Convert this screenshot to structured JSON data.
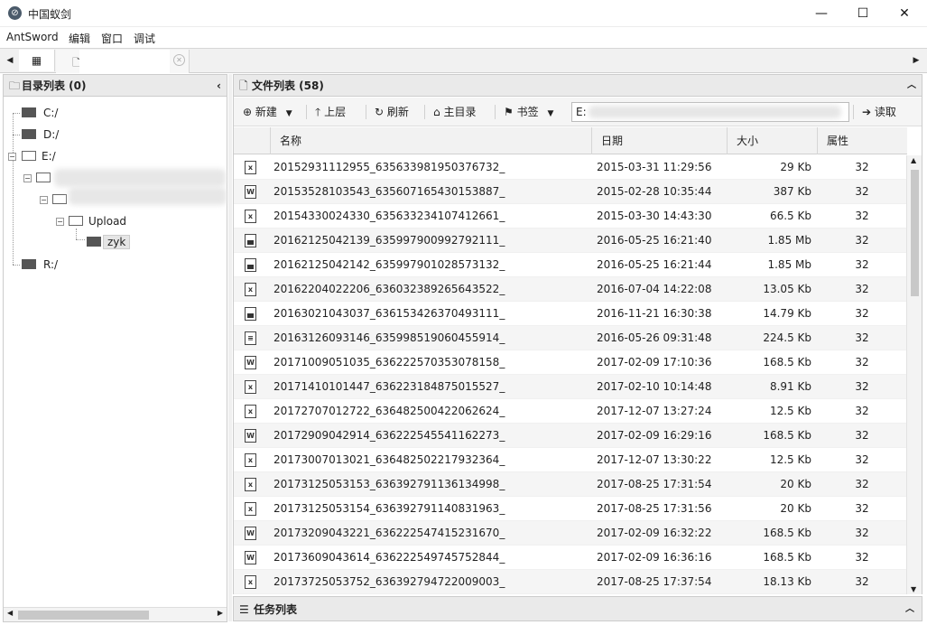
{
  "window": {
    "title": "中国蚁剑",
    "min": "—",
    "max": "☐",
    "close": "✕"
  },
  "menu": [
    "AntSword",
    "编辑",
    "窗口",
    "调试"
  ],
  "dir_panel": {
    "title": "目录列表 (0)"
  },
  "tree": {
    "c": "C:/",
    "d": "D:/",
    "e": "E:/",
    "upload": "Upload",
    "zyk": "zyk",
    "r": "R:/"
  },
  "file_panel": {
    "title": "文件列表 (58)"
  },
  "toolbar": {
    "new": "新建",
    "up": "上层",
    "refresh": "刷新",
    "home": "主目录",
    "bookmark": "书签",
    "read": "读取",
    "path_prefix": "E:"
  },
  "columns": {
    "name": "名称",
    "date": "日期",
    "size": "大小",
    "attr": "属性"
  },
  "files": [
    {
      "icon": "X",
      "name": "20152931112955_635633981950376732_",
      "date": "2015-03-31 11:29:56",
      "size": "29 Kb",
      "attr": "32"
    },
    {
      "icon": "W",
      "name": "20153528103543_635607165430153887_",
      "date": "2015-02-28 10:35:44",
      "size": "387 Kb",
      "attr": "32"
    },
    {
      "icon": "X",
      "name": "20154330024330_635633234107412661_",
      "date": "2015-03-30 14:43:30",
      "size": "66.5 Kb",
      "attr": "32"
    },
    {
      "icon": "IMG",
      "name": "20162125042139_635997900992792111_",
      "date": "2016-05-25 16:21:40",
      "size": "1.85 Mb",
      "attr": "32"
    },
    {
      "icon": "IMG",
      "name": "20162125042142_635997901028573132_",
      "date": "2016-05-25 16:21:44",
      "size": "1.85 Mb",
      "attr": "32"
    },
    {
      "icon": "X",
      "name": "20162204022206_636032389265643522_",
      "date": "2016-07-04 14:22:08",
      "size": "13.05 Kb",
      "attr": "32"
    },
    {
      "icon": "IMG",
      "name": "20163021043037_636153426370493111_",
      "date": "2016-11-21 16:30:38",
      "size": "14.79 Kb",
      "attr": "32"
    },
    {
      "icon": "TXT",
      "name": "20163126093146_635998519060455914_",
      "date": "2016-05-26 09:31:48",
      "size": "224.5 Kb",
      "attr": "32"
    },
    {
      "icon": "W",
      "name": "20171009051035_636222570353078158_",
      "date": "2017-02-09 17:10:36",
      "size": "168.5 Kb",
      "attr": "32"
    },
    {
      "icon": "X",
      "name": "20171410101447_636223184875015527_",
      "date": "2017-02-10 10:14:48",
      "size": "8.91 Kb",
      "attr": "32"
    },
    {
      "icon": "X",
      "name": "20172707012722_636482500422062624_",
      "date": "2017-12-07 13:27:24",
      "size": "12.5 Kb",
      "attr": "32"
    },
    {
      "icon": "W",
      "name": "20172909042914_636222545541162273_",
      "date": "2017-02-09 16:29:16",
      "size": "168.5 Kb",
      "attr": "32"
    },
    {
      "icon": "X",
      "name": "20173007013021_636482502217932364_",
      "date": "2017-12-07 13:30:22",
      "size": "12.5 Kb",
      "attr": "32"
    },
    {
      "icon": "X",
      "name": "20173125053153_636392791136134998_",
      "date": "2017-08-25 17:31:54",
      "size": "20 Kb",
      "attr": "32"
    },
    {
      "icon": "X",
      "name": "20173125053154_636392791140831963_",
      "date": "2017-08-25 17:31:56",
      "size": "20 Kb",
      "attr": "32"
    },
    {
      "icon": "W",
      "name": "20173209043221_636222547415231670_",
      "date": "2017-02-09 16:32:22",
      "size": "168.5 Kb",
      "attr": "32"
    },
    {
      "icon": "W",
      "name": "20173609043614_636222549745752844_",
      "date": "2017-02-09 16:36:16",
      "size": "168.5 Kb",
      "attr": "32"
    },
    {
      "icon": "X",
      "name": "20173725053752_636392794722009003_",
      "date": "2017-08-25 17:37:54",
      "size": "18.13 Kb",
      "attr": "32"
    }
  ],
  "task_panel": {
    "title": "任务列表"
  },
  "icons": {
    "app": "antsword-logo-icon",
    "dir": "folder-outline-icon",
    "file": "document-icon",
    "new": "plus-circle-icon",
    "up": "arrow-up-icon",
    "refresh": "refresh-icon",
    "home": "home-icon",
    "bookmark": "bookmark-icon",
    "read": "arrow-right-icon",
    "task": "list-icon"
  }
}
